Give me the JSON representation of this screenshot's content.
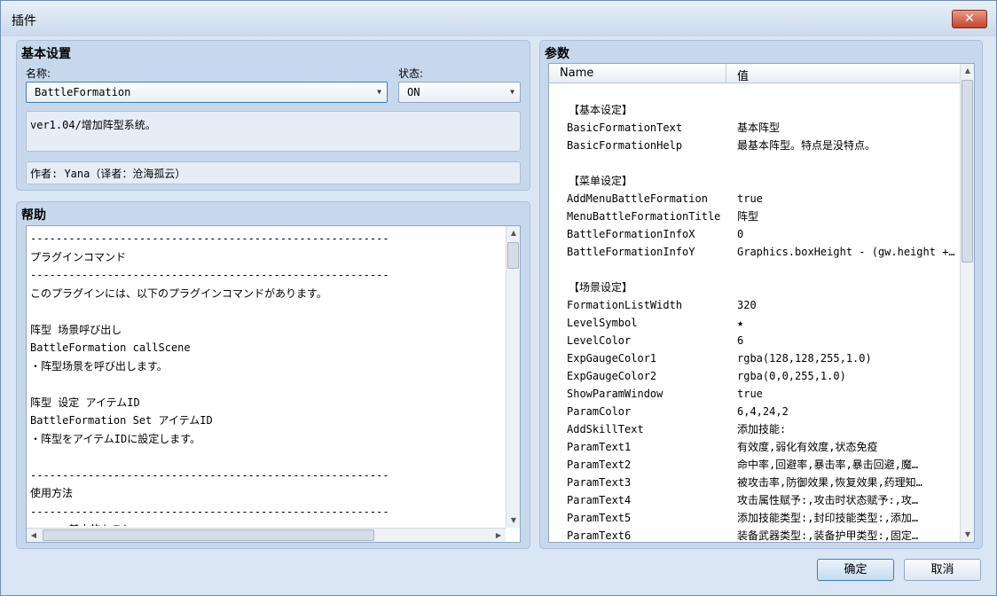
{
  "window": {
    "title": "插件",
    "close_symbol": "✕"
  },
  "basic": {
    "title": "基本设置",
    "name_label": "名称:",
    "name_value": "BattleFormation",
    "status_label": "状态:",
    "status_value": "ON",
    "description": "ver1.04/增加阵型系统。",
    "author": "作者: Yana（译者：沧海孤云）"
  },
  "help": {
    "title": "帮助",
    "lines": [
      "--------------------------------------------------------",
      "プラグインコマンド",
      "--------------------------------------------------------",
      "このプラグインには、以下のプラグインコマンドがあります。",
      "",
      "阵型 场景呼び出し",
      "BattleFormation callScene",
      "・阵型场景を呼び出します。",
      "",
      "阵型 设定 アイテムID",
      "BattleFormation Set アイテムID",
      "・阵型をアイテムIDに設定します。",
      "",
      "--------------------------------------------------------",
      "使用方法",
      "--------------------------------------------------------",
      "      基本的なこと"
    ]
  },
  "params": {
    "title": "参数",
    "col_name": "Name",
    "col_value": "值",
    "rows": [
      {
        "type": "blank"
      },
      {
        "type": "section",
        "label": "【基本设定】"
      },
      {
        "type": "param",
        "name": "BasicFormationText",
        "value": "基本阵型"
      },
      {
        "type": "param",
        "name": "BasicFormationHelp",
        "value": "最基本阵型。特点是没特点。"
      },
      {
        "type": "blank"
      },
      {
        "type": "section",
        "label": "【菜单设定】"
      },
      {
        "type": "param",
        "name": "AddMenuBattleFormation",
        "value": "true"
      },
      {
        "type": "param",
        "name": "MenuBattleFormationTitle",
        "value": "阵型"
      },
      {
        "type": "param",
        "name": "BattleFormationInfoX",
        "value": "0"
      },
      {
        "type": "param",
        "name": "BattleFormationInfoY",
        "value": "Graphics.boxHeight - (gw.height + h)"
      },
      {
        "type": "blank"
      },
      {
        "type": "section",
        "label": "【场景设定】"
      },
      {
        "type": "param",
        "name": "FormationListWidth",
        "value": "320"
      },
      {
        "type": "param",
        "name": "LevelSymbol",
        "value": "★"
      },
      {
        "type": "param",
        "name": "LevelColor",
        "value": "6"
      },
      {
        "type": "param",
        "name": "ExpGaugeColor1",
        "value": "rgba(128,128,255,1.0)"
      },
      {
        "type": "param",
        "name": "ExpGaugeColor2",
        "value": "rgba(0,0,255,1.0)"
      },
      {
        "type": "param",
        "name": "ShowParamWindow",
        "value": "true"
      },
      {
        "type": "param",
        "name": "ParamColor",
        "value": "6,4,24,2"
      },
      {
        "type": "param",
        "name": "AddSkillText",
        "value": "添加技能:"
      },
      {
        "type": "param",
        "name": "ParamText1",
        "value": "有效度,弱化有效度,状态免疫"
      },
      {
        "type": "param",
        "name": "ParamText2",
        "value": "命中率,回避率,暴击率,暴击回避,魔…"
      },
      {
        "type": "param",
        "name": "ParamText3",
        "value": "被攻击率,防御效果,恢复效果,药理知…"
      },
      {
        "type": "param",
        "name": "ParamText4",
        "value": "攻击属性赋予:,攻击时状态赋予:,攻…"
      },
      {
        "type": "param",
        "name": "ParamText5",
        "value": "添加技能类型:,封印技能类型:,添加…"
      },
      {
        "type": "param",
        "name": "ParamText6",
        "value": "装备武器类型:,装备护甲类型:,固定…"
      }
    ]
  },
  "footer": {
    "ok_label": "确定",
    "cancel_label": "取消"
  },
  "scroll": {
    "left_arrow": "◀",
    "right_arrow": "▶",
    "up_arrow": "▲",
    "down_arrow": "▼"
  },
  "icons": {
    "dropdown": "▼"
  }
}
